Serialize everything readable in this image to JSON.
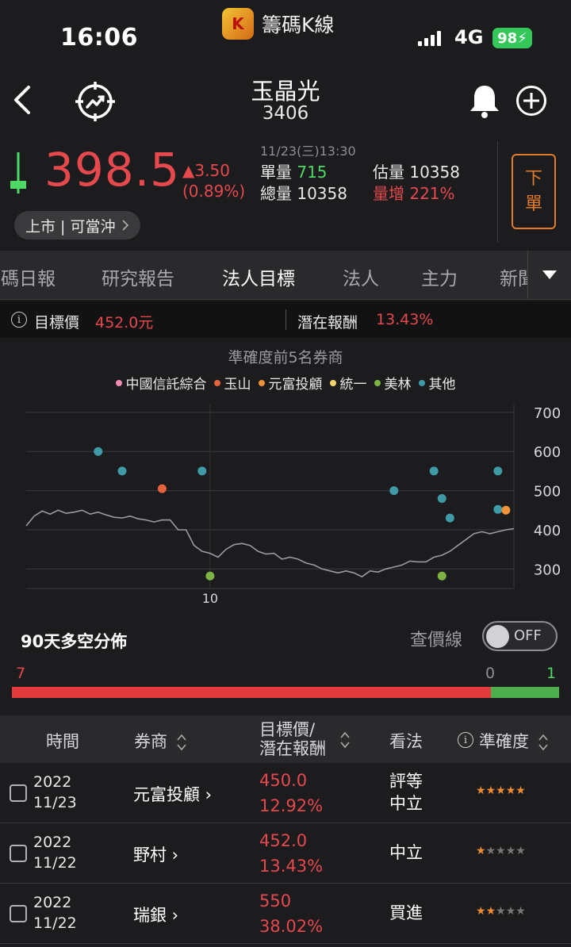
{
  "status_bar": {
    "time": "16:06",
    "app_name": "籌碼K線",
    "network": "4G",
    "battery": "98"
  },
  "header": {
    "stock_name": "玉晶光",
    "stock_code": "3406"
  },
  "quote": {
    "price": "398.5",
    "change": "▲3.50",
    "change_pct": "(0.89%)",
    "timestamp": "11/23(三)13:30",
    "unit_volume_label": "單量",
    "unit_volume": "715",
    "est_volume_label": "估量",
    "est_volume": "10358",
    "total_volume_label": "總量",
    "total_volume": "10358",
    "volume_increase_label": "量增",
    "volume_increase": "221%",
    "order_button": [
      "下",
      "單"
    ],
    "market_tag": "上市 | 可當沖"
  },
  "tabs": [
    "籌碼日報",
    "研究報告",
    "法人目標",
    "法人",
    "主力",
    "新聞"
  ],
  "active_tab": 2,
  "target": {
    "label": "目標價",
    "value": "452.0元",
    "return_label": "潛在報酬",
    "return_value": "13.43%"
  },
  "chart": {
    "title": "準確度前5名券商",
    "legend": [
      {
        "name": "中國信託綜合",
        "color": "#f28cb4"
      },
      {
        "name": "玉山",
        "color": "#e5623a"
      },
      {
        "name": "元富投顧",
        "color": "#f0923a"
      },
      {
        "name": "統一",
        "color": "#f2d46b"
      },
      {
        "name": "美林",
        "color": "#7cb342"
      },
      {
        "name": "其他",
        "color": "#3f9aa8"
      }
    ]
  },
  "chart_data": {
    "type": "scatter",
    "title": "準確度前5名券商",
    "y_ticks": [
      700,
      600,
      500,
      400,
      300
    ],
    "ylim": [
      250,
      720
    ],
    "x_tick_label": "10",
    "price_line": [
      410,
      435,
      448,
      440,
      450,
      442,
      445,
      450,
      440,
      445,
      438,
      432,
      430,
      435,
      428,
      425,
      420,
      425,
      425,
      400,
      400,
      360,
      345,
      340,
      330,
      350,
      362,
      365,
      360,
      345,
      338,
      340,
      325,
      330,
      325,
      315,
      310,
      300,
      295,
      290,
      295,
      290,
      280,
      295,
      292,
      300,
      305,
      310,
      320,
      318,
      318,
      330,
      335,
      345,
      360,
      375,
      390,
      395,
      390,
      395,
      400,
      403
    ],
    "points": [
      {
        "series": "其他",
        "i": 9,
        "y": 600
      },
      {
        "series": "其他",
        "i": 12,
        "y": 550
      },
      {
        "series": "玉山",
        "i": 17,
        "y": 505
      },
      {
        "series": "其他",
        "i": 22,
        "y": 550
      },
      {
        "series": "美林",
        "i": 23,
        "y": 282
      },
      {
        "series": "其他",
        "i": 46,
        "y": 500
      },
      {
        "series": "其他",
        "i": 51,
        "y": 550
      },
      {
        "series": "其他",
        "i": 52,
        "y": 480
      },
      {
        "series": "美林",
        "i": 52,
        "y": 282
      },
      {
        "series": "其他",
        "i": 53,
        "y": 430
      },
      {
        "series": "其他",
        "i": 59,
        "y": 550
      },
      {
        "series": "其他",
        "i": 59,
        "y": 452
      },
      {
        "series": "元富投顧",
        "i": 60,
        "y": 450
      }
    ]
  },
  "distribution": {
    "title": "90天多空分佈",
    "check_line_label": "查價線",
    "toggle": "OFF",
    "bull": "7",
    "neutral": "0",
    "bear": "1",
    "bull_fraction": 0.875
  },
  "table": {
    "headers": {
      "time": "時間",
      "broker": "券商",
      "target1": "目標價/",
      "target2": "潛在報酬",
      "view": "看法",
      "accuracy": "準確度"
    },
    "rows": [
      {
        "year": "2022",
        "date": "11/23",
        "broker": "元富投顧 ›",
        "price": "450.0",
        "ret": "12.92%",
        "view1": "評等",
        "view2": "中立",
        "stars": 5
      },
      {
        "year": "2022",
        "date": "11/22",
        "broker": "野村 ›",
        "price": "452.0",
        "ret": "13.43%",
        "view1": "中立",
        "view2": "",
        "stars": 1
      },
      {
        "year": "2022",
        "date": "11/22",
        "broker": "瑞銀 ›",
        "price": "550",
        "ret": "38.02%",
        "view1": "買進",
        "view2": "",
        "stars": 2
      }
    ]
  }
}
